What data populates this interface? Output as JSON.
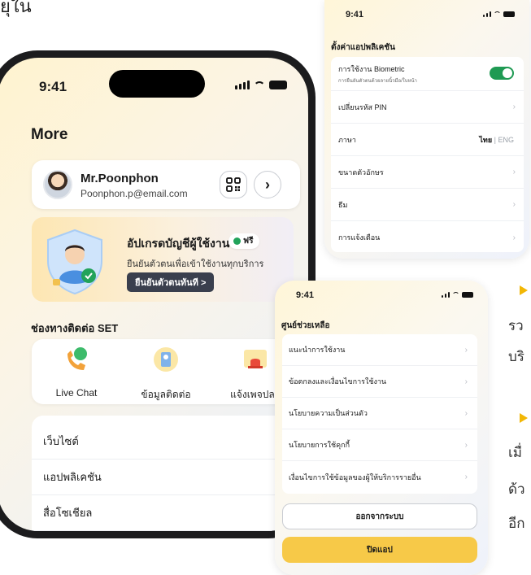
{
  "colors": {
    "accent": "#f7c948",
    "toggle_on": "#1f9a53",
    "badge_green": "#22a35a"
  },
  "corner_text": "ยุใน",
  "main_phone": {
    "time": "9:41",
    "title": "More",
    "profile": {
      "name": "Mr.Poonphon",
      "email": "Poonphon.p@email.com",
      "qr_icon": "qr-code-icon",
      "chevron_icon": "chevron-right-icon"
    },
    "upgrade": {
      "title": "อัปเกรดบัญชีผู้ใช้งาน",
      "badge": "ฟรี",
      "subtitle": "ยืนยันตัวตนเพื่อเข้าใช้งานทุกบริการ",
      "button": "ยืนยันตัวตนทันที >"
    },
    "contact_section_title": "ช่องทางติดต่อ SET",
    "contacts": [
      {
        "label": "Live Chat",
        "icon": "chat-phone-icon"
      },
      {
        "label": "ข้อมูลติดต่อ",
        "icon": "contact-info-icon"
      },
      {
        "label": "แจ้งเพจปลอ",
        "icon": "alert-siren-icon"
      }
    ],
    "menu": [
      "เว็บไซต์",
      "แอปพลิเคชัน",
      "สื่อโซเชียล"
    ]
  },
  "settings_phone": {
    "time": "9:41",
    "header": "ตั้งค่าแอปพลิเคชัน",
    "biometric": {
      "label": "การใช้งาน Biometric",
      "sublabel": "การยืนยันตัวตนด้วยลายนิ้วมือ/ใบหน้า",
      "enabled": true
    },
    "rows": [
      "เปลี่ยนรหัส PIN",
      "ภาษา",
      "ขนาดตัวอักษร",
      "ธีม",
      "การแจ้งเตือน"
    ],
    "language": {
      "active": "ไทย",
      "separator": "|",
      "other": "ENG"
    }
  },
  "help_phone": {
    "time": "9:41",
    "header": "ศูนย์ช่วยเหลือ",
    "rows": [
      "แนะนำการใช้งาน",
      "ข้อตกลงและเงื่อนไขการใช้งาน",
      "นโยบายความเป็นส่วนตัว",
      "นโยบายการใช้คุกกี้",
      "เงื่อนไขการใช้ข้อมูลของผู้ให้บริการรายอื่น"
    ],
    "logout_button": "ออกจากระบบ",
    "close_button": "ปิดแอป"
  },
  "side_text": [
    "รว",
    "บริ",
    "เมื่",
    "ด้ว",
    "อีก"
  ]
}
